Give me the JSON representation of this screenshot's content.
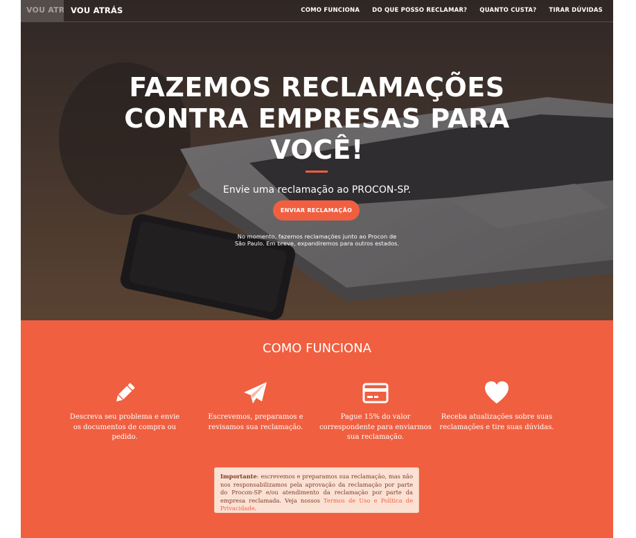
{
  "colors": {
    "accent": "#f05f40",
    "notice_bg": "#fbe1d4",
    "text_light": "#ffffff"
  },
  "navbar": {
    "brand_ghost": "VOU ATRÁS",
    "brand": "VOU ATRÁS",
    "links": [
      {
        "label": "COMO FUNCIONA"
      },
      {
        "label": "DO QUE POSSO RECLAMAR?"
      },
      {
        "label": "QUANTO CUSTA?"
      },
      {
        "label": "TIRAR DÚVIDAS"
      }
    ]
  },
  "hero": {
    "title_lines": [
      "FAZEMOS RECLAMAÇÕES",
      "CONTRA EMPRESAS PARA",
      "VOCÊ!"
    ],
    "subtitle": "Envie uma reclamação ao PROCON-SP.",
    "cta_label": "ENVIAR RECLAMAÇÃO",
    "note": "No momento, fazemos reclamações junto ao Procon de São Paulo. Em breve, expandiremos para outros estados."
  },
  "how_it_works": {
    "title": "COMO FUNCIONA",
    "steps": [
      {
        "icon": "pencil-icon",
        "text": "Descreva seu problema e envie os documentos de compra ou pedido."
      },
      {
        "icon": "paper-plane-icon",
        "text": "Escrevemos, preparamos e revisamos sua reclamação."
      },
      {
        "icon": "credit-card-icon",
        "text": "Pague 15% do valor correspondente para enviarmos sua reclamação."
      },
      {
        "icon": "heart-icon",
        "text": "Receba atualizações sobre suas reclamações e tire suas dúvidas."
      }
    ],
    "notice": {
      "label": "Importante",
      "text": ": escrevemos e preparamos sua reclamação, mas não nos responsabilizamos pela aprovação da reclamação por parte do Procon-SP e/ou atendimento da reclamação por parte da empresa reclamada. Veja nossos ",
      "link": "Termos de Uso e Política de Privacidade",
      "end": "."
    }
  }
}
